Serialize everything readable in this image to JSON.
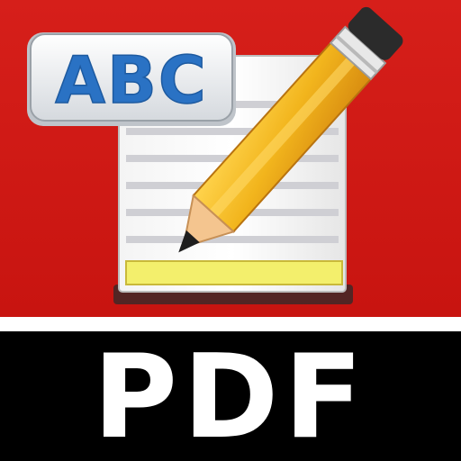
{
  "icon": {
    "bottom_label": "PDF",
    "badge_text": "ABC",
    "illustration": "notepad-with-pencil-icon",
    "colors": {
      "background_top": "#d61f1a",
      "divider": "#ffffff",
      "background_bottom": "#000000",
      "label_text": "#ffffff",
      "badge_text": "#2a72c4",
      "pencil_body": "#f2b51d",
      "highlight_bar": "#f3ef6c"
    }
  }
}
